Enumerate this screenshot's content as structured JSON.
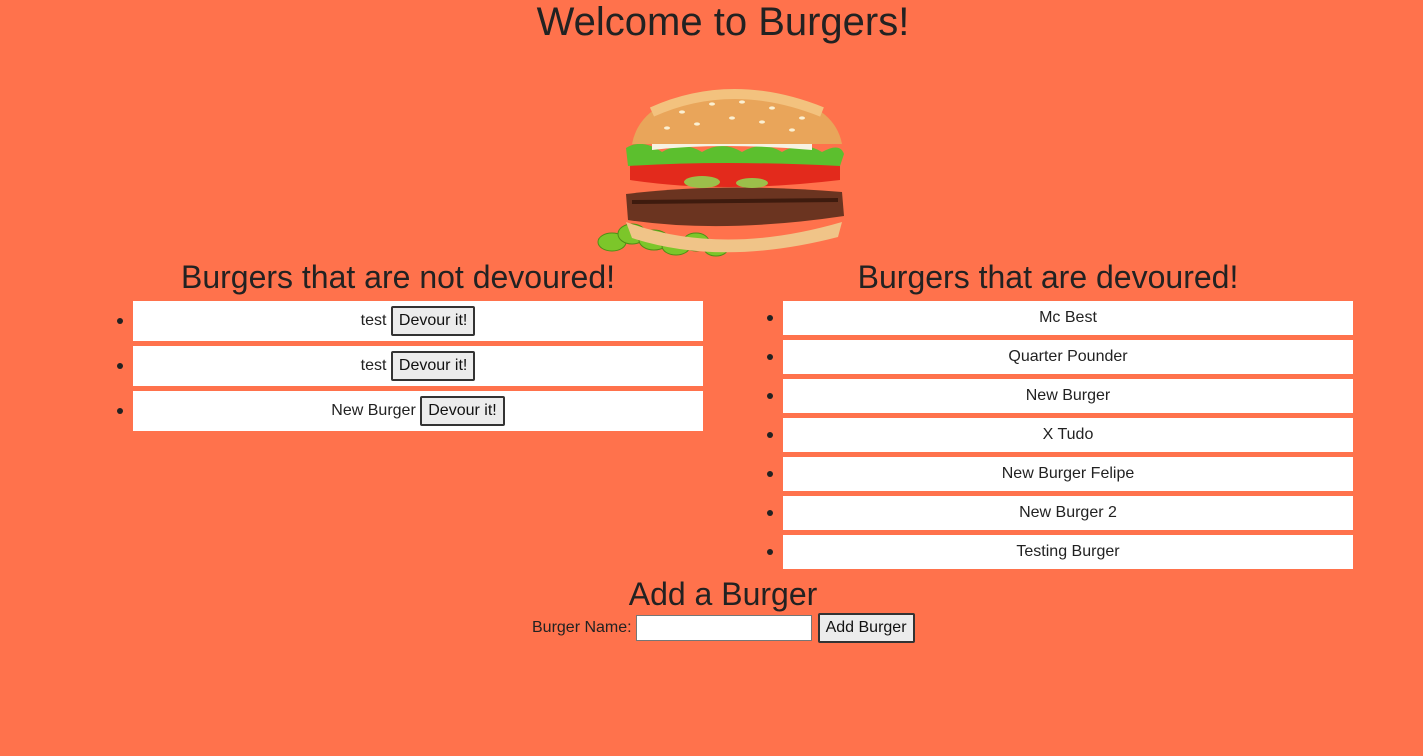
{
  "page": {
    "title": "Welcome to Burgers!"
  },
  "not_devoured": {
    "heading": "Burgers that are not devoured!",
    "button_label": "Devour it!",
    "items": [
      {
        "name": "test"
      },
      {
        "name": "test"
      },
      {
        "name": "New Burger"
      }
    ]
  },
  "devoured": {
    "heading": "Burgers that are devoured!",
    "items": [
      {
        "name": "Mc Best"
      },
      {
        "name": "Quarter Pounder"
      },
      {
        "name": "New Burger"
      },
      {
        "name": "X Tudo"
      },
      {
        "name": "New Burger Felipe"
      },
      {
        "name": "New Burger 2"
      },
      {
        "name": "Testing Burger"
      }
    ]
  },
  "add_form": {
    "heading": "Add a Burger",
    "label": "Burger Name:",
    "value": "",
    "button_label": "Add Burger"
  },
  "colors": {
    "background": "#ff724c",
    "card": "#ffffff"
  }
}
